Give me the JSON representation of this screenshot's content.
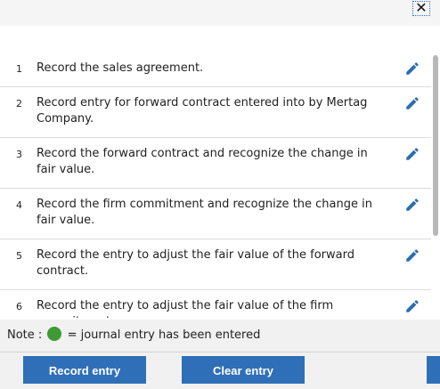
{
  "header": {
    "close_glyph": "✕"
  },
  "entries": [
    {
      "num": "1",
      "text": "Record the sales agreement."
    },
    {
      "num": "2",
      "text": "Record entry for forward contract entered into by Mertag Company."
    },
    {
      "num": "3",
      "text": "Record the forward contract and recognize the change in fair value."
    },
    {
      "num": "4",
      "text": "Record the firm commitment and recognize the change in fair value."
    },
    {
      "num": "5",
      "text": "Record the entry to adjust the fair value of the forward contract."
    },
    {
      "num": "6",
      "text": "Record the entry to adjust the fair value of the firm commitment."
    }
  ],
  "note": {
    "prefix": "Note :",
    "suffix": "= journal entry has been entered",
    "dot_color": "#3e9a35"
  },
  "buttons": {
    "record": "Record entry",
    "clear": "Clear entry"
  },
  "colors": {
    "accent": "#2f6fb8",
    "edit_icon": "#2a6db0"
  }
}
